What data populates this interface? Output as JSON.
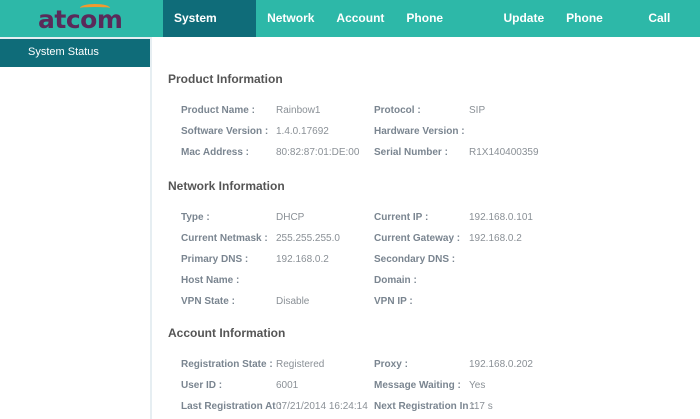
{
  "brand": {
    "logo": "atcom",
    "logo_colors": {
      "text": "#5a2a5a",
      "arc": "#f29a2e"
    }
  },
  "colors": {
    "header": "#2db8a8",
    "active": "#0f6c79"
  },
  "nav": [
    {
      "label": "System Status",
      "active": true
    },
    {
      "label": "Network"
    },
    {
      "label": "Account"
    },
    {
      "label": "Phone Settings"
    },
    {
      "label": "Update"
    },
    {
      "label": "Phone Book"
    },
    {
      "label": "Call Log"
    }
  ],
  "sidebar": {
    "items": [
      {
        "label": "System Status",
        "active": true
      }
    ]
  },
  "sections": [
    {
      "title": "Product Information",
      "rows": [
        [
          "Product Name :",
          "Rainbow1",
          "Protocol :",
          "SIP"
        ],
        [
          "Software Version :",
          "1.4.0.17692",
          "Hardware Version :",
          ""
        ],
        [
          "Mac Address :",
          "80:82:87:01:DE:00",
          "Serial Number :",
          "R1X140400359"
        ]
      ]
    },
    {
      "title": "Network Information",
      "rows": [
        [
          "Type :",
          "DHCP",
          "Current IP :",
          "192.168.0.101"
        ],
        [
          "Current Netmask :",
          "255.255.255.0",
          "Current Gateway :",
          "192.168.0.2"
        ],
        [
          "Primary DNS :",
          "192.168.0.2",
          "Secondary DNS :",
          ""
        ],
        [
          "Host Name :",
          "",
          "Domain :",
          ""
        ],
        [
          "VPN State :",
          "Disable",
          "VPN IP :",
          ""
        ]
      ]
    },
    {
      "title": "Account Information",
      "rows": [
        [
          "Registration State :",
          "Registered",
          "Proxy :",
          "192.168.0.202"
        ],
        [
          "User ID :",
          "6001",
          "Message Waiting :",
          "Yes"
        ],
        [
          "Last Registration At :",
          "07/21/2014 16:24:14",
          "Next Registration In :",
          "117 s"
        ]
      ]
    }
  ]
}
